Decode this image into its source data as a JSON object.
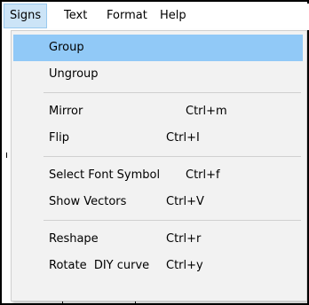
{
  "menubar": {
    "items": [
      {
        "label": "Signs",
        "active": true
      },
      {
        "label": "Text"
      },
      {
        "label": "Format"
      },
      {
        "label": "Help"
      }
    ]
  },
  "signs_menu": {
    "highlighted_color": "#91c9f7",
    "groups": [
      [
        {
          "label": "Group",
          "shortcut": "",
          "highlighted": true
        },
        {
          "label": "Ungroup",
          "shortcut": ""
        }
      ],
      [
        {
          "label": "Mirror",
          "shortcut": "Ctrl+m"
        },
        {
          "label": "Flip",
          "shortcut": "Ctrl+I"
        }
      ],
      [
        {
          "label": "Select Font Symbol",
          "shortcut": "Ctrl+f"
        },
        {
          "label": "Show Vectors",
          "shortcut": "Ctrl+V"
        }
      ],
      [
        {
          "label": "Reshape",
          "shortcut": "Ctrl+r"
        },
        {
          "label": "Rotate  DIY curve",
          "shortcut": "Ctrl+y"
        }
      ]
    ]
  }
}
